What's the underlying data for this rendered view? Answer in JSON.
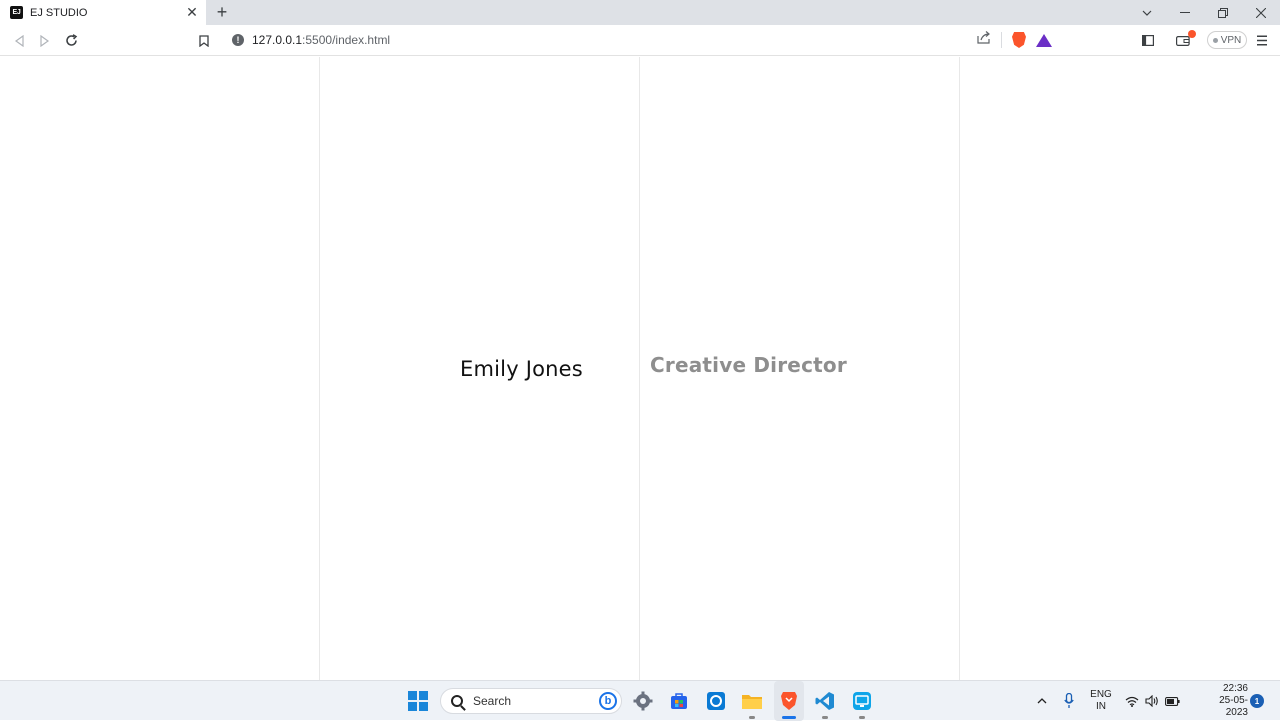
{
  "browser": {
    "tab": {
      "favicon_text": "EJ",
      "title": "EJ STUDIO",
      "close_glyph": "✕"
    },
    "new_tab_glyph": "+",
    "url": {
      "host": "127.0.0.1",
      "path": ":5500/index.html"
    },
    "vpn_label": "VPN",
    "icons": [
      "back-icon",
      "forward-icon",
      "reload-icon",
      "bookmark-icon",
      "share-icon",
      "brave-shields-icon",
      "brave-rewards-icon",
      "sidebar-icon",
      "wallet-icon",
      "menu-icon"
    ],
    "accent": "#fb542b"
  },
  "page": {
    "name": "Emily Jones",
    "role": "Creative Director"
  },
  "taskbar": {
    "search_label": "Search",
    "language": {
      "line1": "ENG",
      "line2": "IN"
    },
    "clock": {
      "time": "22:36",
      "date": "25-05-2023"
    },
    "notification_count": "1",
    "apps": [
      "start-icon",
      "settings-icon",
      "store-icon",
      "cortana-icon",
      "file-explorer-icon",
      "brave-browser-icon",
      "vscode-icon",
      "rdp-icon"
    ]
  }
}
